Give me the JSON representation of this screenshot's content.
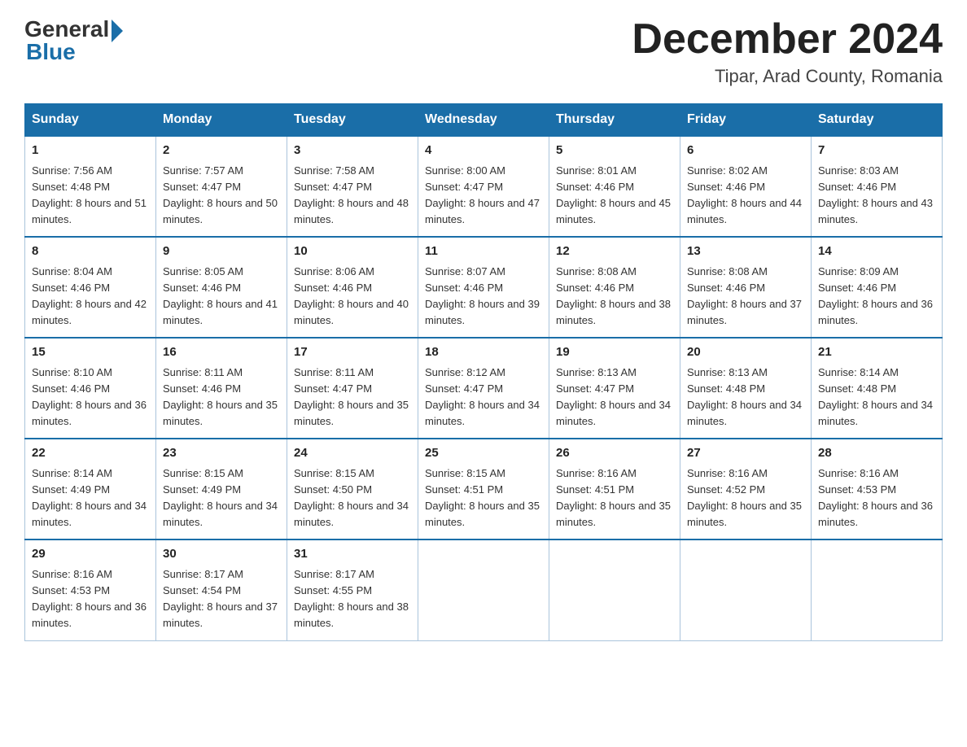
{
  "logo": {
    "general_text": "General",
    "blue_text": "Blue"
  },
  "title": {
    "month_year": "December 2024",
    "location": "Tipar, Arad County, Romania"
  },
  "headers": [
    "Sunday",
    "Monday",
    "Tuesday",
    "Wednesday",
    "Thursday",
    "Friday",
    "Saturday"
  ],
  "weeks": [
    [
      {
        "day": "1",
        "sunrise": "7:56 AM",
        "sunset": "4:48 PM",
        "daylight": "8 hours and 51 minutes."
      },
      {
        "day": "2",
        "sunrise": "7:57 AM",
        "sunset": "4:47 PM",
        "daylight": "8 hours and 50 minutes."
      },
      {
        "day": "3",
        "sunrise": "7:58 AM",
        "sunset": "4:47 PM",
        "daylight": "8 hours and 48 minutes."
      },
      {
        "day": "4",
        "sunrise": "8:00 AM",
        "sunset": "4:47 PM",
        "daylight": "8 hours and 47 minutes."
      },
      {
        "day": "5",
        "sunrise": "8:01 AM",
        "sunset": "4:46 PM",
        "daylight": "8 hours and 45 minutes."
      },
      {
        "day": "6",
        "sunrise": "8:02 AM",
        "sunset": "4:46 PM",
        "daylight": "8 hours and 44 minutes."
      },
      {
        "day": "7",
        "sunrise": "8:03 AM",
        "sunset": "4:46 PM",
        "daylight": "8 hours and 43 minutes."
      }
    ],
    [
      {
        "day": "8",
        "sunrise": "8:04 AM",
        "sunset": "4:46 PM",
        "daylight": "8 hours and 42 minutes."
      },
      {
        "day": "9",
        "sunrise": "8:05 AM",
        "sunset": "4:46 PM",
        "daylight": "8 hours and 41 minutes."
      },
      {
        "day": "10",
        "sunrise": "8:06 AM",
        "sunset": "4:46 PM",
        "daylight": "8 hours and 40 minutes."
      },
      {
        "day": "11",
        "sunrise": "8:07 AM",
        "sunset": "4:46 PM",
        "daylight": "8 hours and 39 minutes."
      },
      {
        "day": "12",
        "sunrise": "8:08 AM",
        "sunset": "4:46 PM",
        "daylight": "8 hours and 38 minutes."
      },
      {
        "day": "13",
        "sunrise": "8:08 AM",
        "sunset": "4:46 PM",
        "daylight": "8 hours and 37 minutes."
      },
      {
        "day": "14",
        "sunrise": "8:09 AM",
        "sunset": "4:46 PM",
        "daylight": "8 hours and 36 minutes."
      }
    ],
    [
      {
        "day": "15",
        "sunrise": "8:10 AM",
        "sunset": "4:46 PM",
        "daylight": "8 hours and 36 minutes."
      },
      {
        "day": "16",
        "sunrise": "8:11 AM",
        "sunset": "4:46 PM",
        "daylight": "8 hours and 35 minutes."
      },
      {
        "day": "17",
        "sunrise": "8:11 AM",
        "sunset": "4:47 PM",
        "daylight": "8 hours and 35 minutes."
      },
      {
        "day": "18",
        "sunrise": "8:12 AM",
        "sunset": "4:47 PM",
        "daylight": "8 hours and 34 minutes."
      },
      {
        "day": "19",
        "sunrise": "8:13 AM",
        "sunset": "4:47 PM",
        "daylight": "8 hours and 34 minutes."
      },
      {
        "day": "20",
        "sunrise": "8:13 AM",
        "sunset": "4:48 PM",
        "daylight": "8 hours and 34 minutes."
      },
      {
        "day": "21",
        "sunrise": "8:14 AM",
        "sunset": "4:48 PM",
        "daylight": "8 hours and 34 minutes."
      }
    ],
    [
      {
        "day": "22",
        "sunrise": "8:14 AM",
        "sunset": "4:49 PM",
        "daylight": "8 hours and 34 minutes."
      },
      {
        "day": "23",
        "sunrise": "8:15 AM",
        "sunset": "4:49 PM",
        "daylight": "8 hours and 34 minutes."
      },
      {
        "day": "24",
        "sunrise": "8:15 AM",
        "sunset": "4:50 PM",
        "daylight": "8 hours and 34 minutes."
      },
      {
        "day": "25",
        "sunrise": "8:15 AM",
        "sunset": "4:51 PM",
        "daylight": "8 hours and 35 minutes."
      },
      {
        "day": "26",
        "sunrise": "8:16 AM",
        "sunset": "4:51 PM",
        "daylight": "8 hours and 35 minutes."
      },
      {
        "day": "27",
        "sunrise": "8:16 AM",
        "sunset": "4:52 PM",
        "daylight": "8 hours and 35 minutes."
      },
      {
        "day": "28",
        "sunrise": "8:16 AM",
        "sunset": "4:53 PM",
        "daylight": "8 hours and 36 minutes."
      }
    ],
    [
      {
        "day": "29",
        "sunrise": "8:16 AM",
        "sunset": "4:53 PM",
        "daylight": "8 hours and 36 minutes."
      },
      {
        "day": "30",
        "sunrise": "8:17 AM",
        "sunset": "4:54 PM",
        "daylight": "8 hours and 37 minutes."
      },
      {
        "day": "31",
        "sunrise": "8:17 AM",
        "sunset": "4:55 PM",
        "daylight": "8 hours and 38 minutes."
      },
      null,
      null,
      null,
      null
    ]
  ]
}
